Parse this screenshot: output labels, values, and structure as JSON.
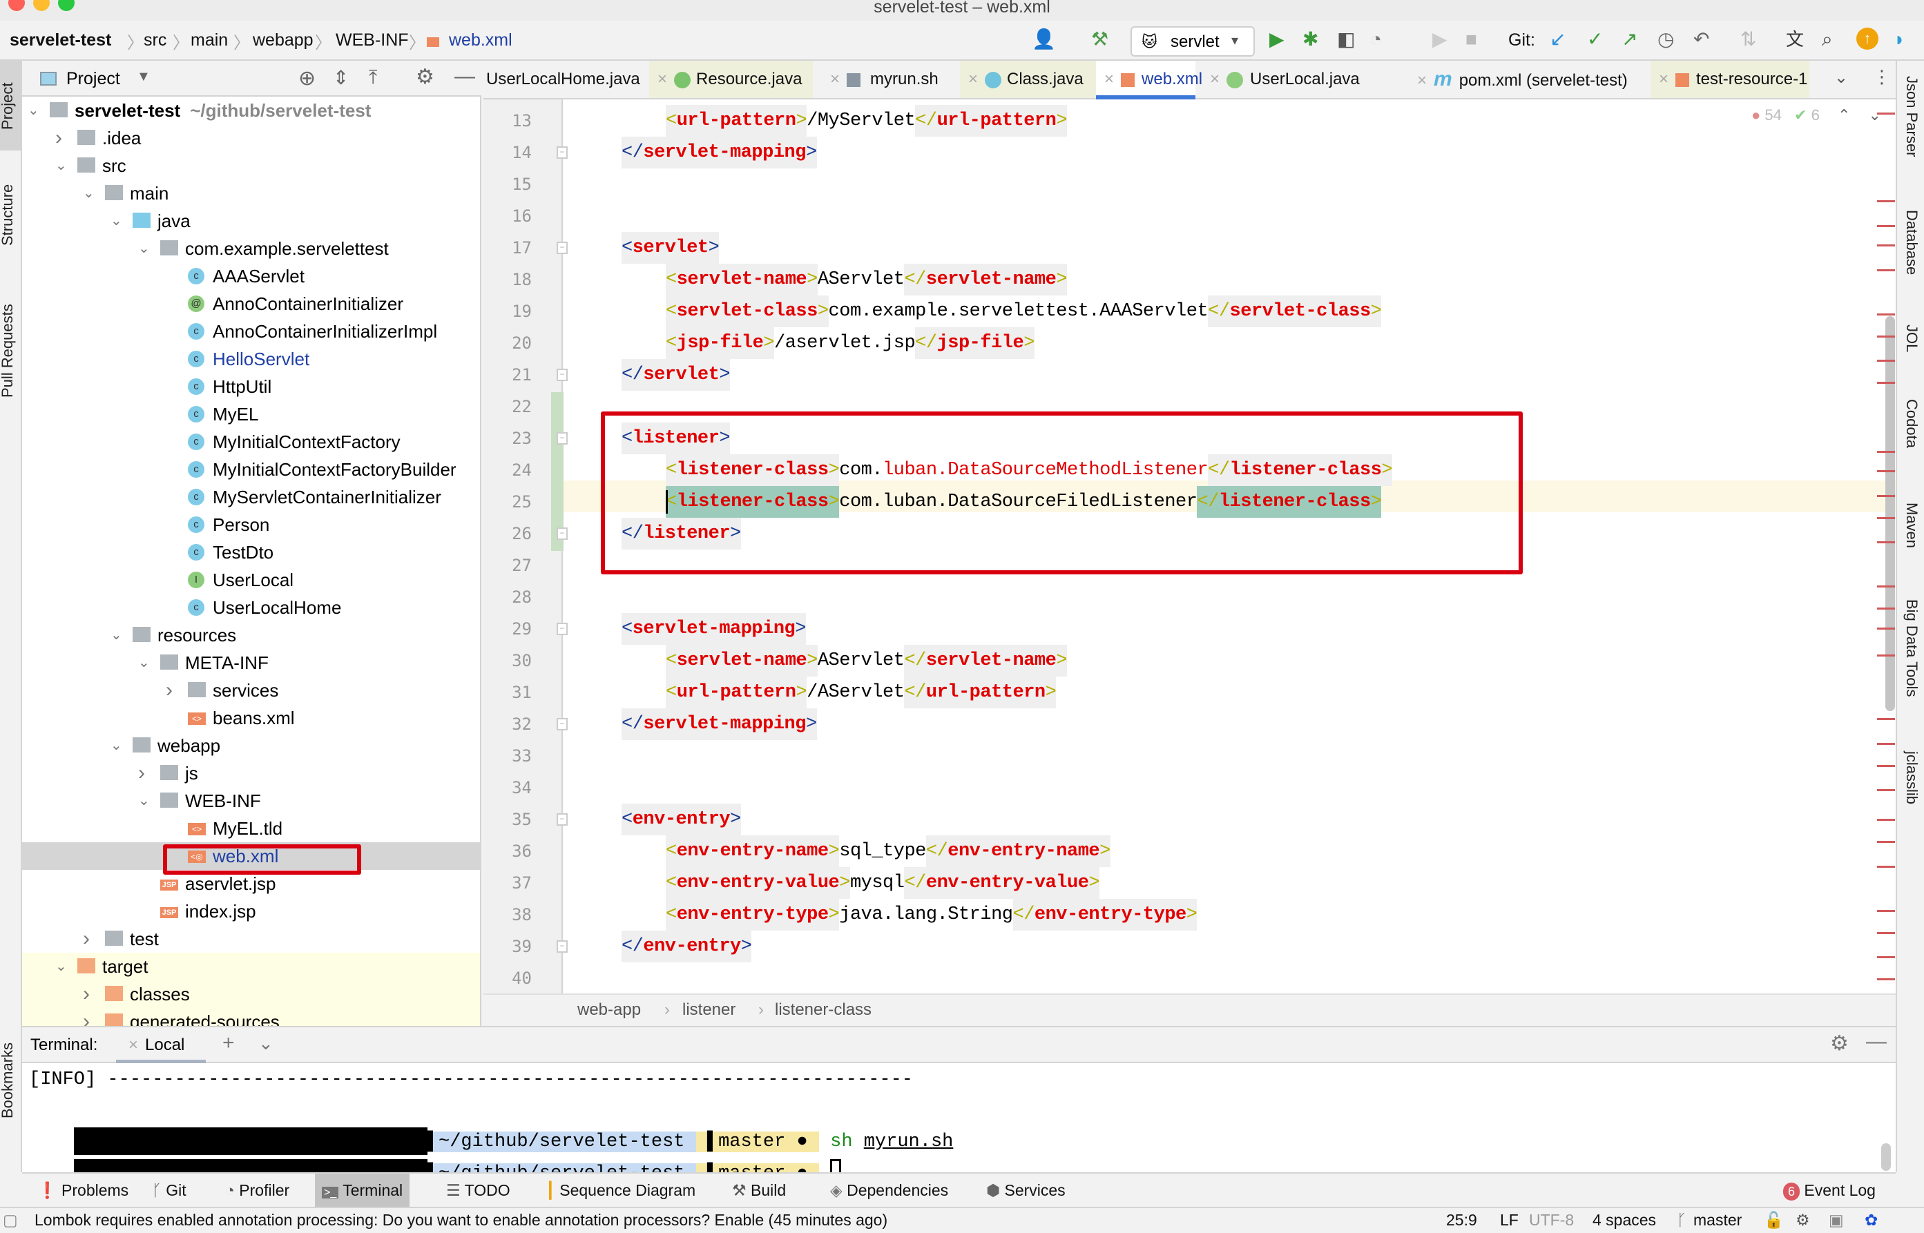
{
  "window": {
    "title": "servelet-test – web.xml"
  },
  "navbar": {
    "breadcrumbs": [
      "servelet-test",
      "src",
      "main",
      "webapp",
      "WEB-INF",
      "web.xml"
    ],
    "run_config": "servlet",
    "git_label": "Git:"
  },
  "left_strip": [
    "Project",
    "Structure",
    "Pull Requests",
    "Bookmarks"
  ],
  "right_strip": [
    "Json Parser",
    "Database",
    "JOL",
    "Codota",
    "Maven",
    "Big Data Tools",
    "jclasslib"
  ],
  "project": {
    "header": "Project",
    "tree": [
      {
        "label": "servelet-test",
        "extra": "~/github/servelet-test",
        "depth": 0,
        "expanded": true,
        "icon": "module",
        "bold": true
      },
      {
        "label": ".idea",
        "depth": 1,
        "expanded": false,
        "icon": "folder"
      },
      {
        "label": "src",
        "depth": 1,
        "expanded": true,
        "icon": "folder"
      },
      {
        "label": "main",
        "depth": 2,
        "expanded": true,
        "icon": "folder"
      },
      {
        "label": "java",
        "depth": 3,
        "expanded": true,
        "icon": "folder-source"
      },
      {
        "label": "com.example.servelettest",
        "depth": 4,
        "expanded": true,
        "icon": "package"
      },
      {
        "label": "AAAServlet",
        "depth": 5,
        "icon": "class"
      },
      {
        "label": "AnnoContainerInitializer",
        "depth": 5,
        "icon": "annotation"
      },
      {
        "label": "AnnoContainerInitializerImpl",
        "depth": 5,
        "icon": "class"
      },
      {
        "label": "HelloServlet",
        "depth": 5,
        "icon": "class",
        "modified": true
      },
      {
        "label": "HttpUtil",
        "depth": 5,
        "icon": "class"
      },
      {
        "label": "MyEL",
        "depth": 5,
        "icon": "class"
      },
      {
        "label": "MyInitialContextFactory",
        "depth": 5,
        "icon": "class"
      },
      {
        "label": "MyInitialContextFactoryBuilder",
        "depth": 5,
        "icon": "class"
      },
      {
        "label": "MyServletContainerInitializer",
        "depth": 5,
        "icon": "class"
      },
      {
        "label": "Person",
        "depth": 5,
        "icon": "class"
      },
      {
        "label": "TestDto",
        "depth": 5,
        "icon": "class"
      },
      {
        "label": "UserLocal",
        "depth": 5,
        "icon": "interface"
      },
      {
        "label": "UserLocalHome",
        "depth": 5,
        "icon": "class"
      },
      {
        "label": "resources",
        "depth": 3,
        "expanded": true,
        "icon": "folder-resources"
      },
      {
        "label": "META-INF",
        "depth": 4,
        "expanded": true,
        "icon": "folder"
      },
      {
        "label": "services",
        "depth": 5,
        "expanded": false,
        "icon": "folder"
      },
      {
        "label": "beans.xml",
        "depth": 5,
        "icon": "xml"
      },
      {
        "label": "webapp",
        "depth": 3,
        "expanded": true,
        "icon": "folder-web"
      },
      {
        "label": "js",
        "depth": 4,
        "expanded": false,
        "icon": "folder"
      },
      {
        "label": "WEB-INF",
        "depth": 4,
        "expanded": true,
        "icon": "folder"
      },
      {
        "label": "MyEL.tld",
        "depth": 5,
        "icon": "xml"
      },
      {
        "label": "web.xml",
        "depth": 5,
        "icon": "webxml",
        "modified": true,
        "selected": true
      },
      {
        "label": "aservlet.jsp",
        "depth": 4,
        "icon": "jsp"
      },
      {
        "label": "index.jsp",
        "depth": 4,
        "icon": "jsp"
      },
      {
        "label": "test",
        "depth": 2,
        "expanded": false,
        "icon": "folder"
      },
      {
        "label": "target",
        "depth": 1,
        "expanded": true,
        "icon": "folder-excluded",
        "excluded": true
      },
      {
        "label": "classes",
        "depth": 2,
        "expanded": false,
        "icon": "folder-excluded",
        "excluded": true
      },
      {
        "label": "generated-sources",
        "depth": 2,
        "expanded": false,
        "icon": "folder-excluded",
        "excluded": true
      }
    ]
  },
  "tabs": [
    {
      "label": "UserLocalHome.java",
      "icon": "class"
    },
    {
      "label": "Resource.java",
      "icon": "annotation"
    },
    {
      "label": "myrun.sh",
      "icon": "shell"
    },
    {
      "label": "Class.java",
      "icon": "class"
    },
    {
      "label": "web.xml",
      "icon": "webxml",
      "active": true,
      "modified": true
    },
    {
      "label": "UserLocal.java",
      "icon": "interface"
    },
    {
      "label": "pom.xml (servelet-test)",
      "icon": "maven"
    },
    {
      "label": "test-resource-1",
      "icon": "xml"
    }
  ],
  "editor": {
    "errors": "54",
    "warnings": "6",
    "cursor_line": 25,
    "lines": [
      {
        "n": "13",
        "indent": 1,
        "parts": [
          [
            "bi",
            "<"
          ],
          [
            "tn",
            "url-pattern"
          ],
          [
            "bi",
            ">"
          ],
          [
            "t",
            "/MyServlet"
          ],
          [
            "bi",
            "</"
          ],
          [
            "tn",
            "url-pattern"
          ],
          [
            "bi",
            ">"
          ]
        ]
      },
      {
        "n": "14",
        "indent": 0,
        "parts": [
          [
            "bo",
            "</"
          ],
          [
            "tn",
            "servlet-mapping"
          ],
          [
            "bo",
            ">"
          ]
        ]
      },
      {
        "n": "15",
        "indent": 0,
        "parts": []
      },
      {
        "n": "16",
        "indent": 0,
        "parts": []
      },
      {
        "n": "17",
        "indent": 0,
        "parts": [
          [
            "bo",
            "<"
          ],
          [
            "tn",
            "servlet"
          ],
          [
            "bo",
            ">"
          ]
        ]
      },
      {
        "n": "18",
        "indent": 1,
        "parts": [
          [
            "bi",
            "<"
          ],
          [
            "tn",
            "servlet-name"
          ],
          [
            "bi",
            ">"
          ],
          [
            "t",
            "AServlet"
          ],
          [
            "bi",
            "</"
          ],
          [
            "tn",
            "servlet-name"
          ],
          [
            "bi",
            ">"
          ]
        ]
      },
      {
        "n": "19",
        "indent": 1,
        "parts": [
          [
            "bi",
            "<"
          ],
          [
            "tn",
            "servlet-class"
          ],
          [
            "bi",
            ">"
          ],
          [
            "t",
            "com.example.servelettest.AAAServlet"
          ],
          [
            "bi",
            "</"
          ],
          [
            "tn",
            "servlet-class"
          ],
          [
            "bi",
            ">"
          ]
        ]
      },
      {
        "n": "20",
        "indent": 1,
        "parts": [
          [
            "bi",
            "<"
          ],
          [
            "tn",
            "jsp-file"
          ],
          [
            "bi",
            ">"
          ],
          [
            "t",
            "/aservlet.jsp"
          ],
          [
            "bi",
            "</"
          ],
          [
            "tn",
            "jsp-file"
          ],
          [
            "bi",
            ">"
          ]
        ]
      },
      {
        "n": "21",
        "indent": 0,
        "parts": [
          [
            "bo",
            "</"
          ],
          [
            "tn",
            "servlet"
          ],
          [
            "bo",
            ">"
          ]
        ]
      },
      {
        "n": "22",
        "indent": 0,
        "parts": []
      },
      {
        "n": "23",
        "indent": 0,
        "parts": [
          [
            "bo",
            "<"
          ],
          [
            "tn",
            "listener"
          ],
          [
            "bo",
            ">"
          ]
        ]
      },
      {
        "n": "24",
        "indent": 1,
        "parts": [
          [
            "bi",
            "<"
          ],
          [
            "tn",
            "listener-class"
          ],
          [
            "bi",
            ">"
          ],
          [
            "t",
            "com."
          ],
          [
            "u",
            "luban.DataSourceMethodListener"
          ],
          [
            "bi",
            "</"
          ],
          [
            "tn",
            "listener-class"
          ],
          [
            "bi",
            ">"
          ]
        ]
      },
      {
        "n": "25",
        "indent": 1,
        "hl": true,
        "parts": [
          [
            "bi",
            "<"
          ],
          [
            "tn",
            "listener-class"
          ],
          [
            "bi",
            ">"
          ],
          [
            "t",
            "com.luban.DataSourceFiledListener"
          ],
          [
            "bi",
            "</"
          ],
          [
            "tn",
            "listener-class"
          ],
          [
            "bi",
            ">"
          ]
        ]
      },
      {
        "n": "26",
        "indent": 0,
        "parts": [
          [
            "bo",
            "</"
          ],
          [
            "tn",
            "listener"
          ],
          [
            "bo",
            ">"
          ]
        ]
      },
      {
        "n": "27",
        "indent": 0,
        "parts": []
      },
      {
        "n": "28",
        "indent": 0,
        "parts": []
      },
      {
        "n": "29",
        "indent": 0,
        "parts": [
          [
            "bo",
            "<"
          ],
          [
            "tn",
            "servlet-mapping"
          ],
          [
            "bo",
            ">"
          ]
        ]
      },
      {
        "n": "30",
        "indent": 1,
        "parts": [
          [
            "bi",
            "<"
          ],
          [
            "tn",
            "servlet-name"
          ],
          [
            "bi",
            ">"
          ],
          [
            "t",
            "AServlet"
          ],
          [
            "bi",
            "</"
          ],
          [
            "tn",
            "servlet-name"
          ],
          [
            "bi",
            ">"
          ]
        ]
      },
      {
        "n": "31",
        "indent": 1,
        "parts": [
          [
            "bi",
            "<"
          ],
          [
            "tn",
            "url-pattern"
          ],
          [
            "bi",
            ">"
          ],
          [
            "t",
            "/AServlet"
          ],
          [
            "bi",
            "</"
          ],
          [
            "tn",
            "url-pattern"
          ],
          [
            "bi",
            ">"
          ]
        ]
      },
      {
        "n": "32",
        "indent": 0,
        "parts": [
          [
            "bo",
            "</"
          ],
          [
            "tn",
            "servlet-mapping"
          ],
          [
            "bo",
            ">"
          ]
        ]
      },
      {
        "n": "33",
        "indent": 0,
        "parts": []
      },
      {
        "n": "34",
        "indent": 0,
        "parts": []
      },
      {
        "n": "35",
        "indent": 0,
        "parts": [
          [
            "bo",
            "<"
          ],
          [
            "tn",
            "env-entry"
          ],
          [
            "bo",
            ">"
          ]
        ]
      },
      {
        "n": "36",
        "indent": 1,
        "parts": [
          [
            "bi",
            "<"
          ],
          [
            "tn",
            "env-entry-name"
          ],
          [
            "bi",
            ">"
          ],
          [
            "t",
            "sql_type"
          ],
          [
            "bi",
            "</"
          ],
          [
            "tn",
            "env-entry-name"
          ],
          [
            "bi",
            ">"
          ]
        ]
      },
      {
        "n": "37",
        "indent": 1,
        "parts": [
          [
            "bi",
            "<"
          ],
          [
            "tn",
            "env-entry-value"
          ],
          [
            "bi",
            ">"
          ],
          [
            "t",
            "mysql"
          ],
          [
            "bi",
            "</"
          ],
          [
            "tn",
            "env-entry-value"
          ],
          [
            "bi",
            ">"
          ]
        ]
      },
      {
        "n": "38",
        "indent": 1,
        "parts": [
          [
            "bi",
            "<"
          ],
          [
            "tn",
            "env-entry-type"
          ],
          [
            "bi",
            ">"
          ],
          [
            "t",
            "java.lang.String"
          ],
          [
            "bi",
            "</"
          ],
          [
            "tn",
            "env-entry-type"
          ],
          [
            "bi",
            ">"
          ]
        ]
      },
      {
        "n": "39",
        "indent": 0,
        "parts": [
          [
            "bo",
            "</"
          ],
          [
            "tn",
            "env-entry"
          ],
          [
            "bo",
            ">"
          ]
        ]
      },
      {
        "n": "40",
        "indent": 0,
        "parts": []
      }
    ],
    "breadcrumb": [
      "web-app",
      "listener",
      "listener-class"
    ]
  },
  "terminal": {
    "label": "Terminal:",
    "tab": "Local",
    "info_line": "[INFO] ------------------------------------------------------------------------",
    "prompt_path": "~/github/servelet-test",
    "prompt_branch": "master",
    "prompt_dot": "●",
    "command_name": "sh",
    "command_arg": "myrun.sh"
  },
  "toolwindows": [
    "Problems",
    "Git",
    "Profiler",
    "Terminal",
    "TODO",
    "Sequence Diagram",
    "Build",
    "Dependencies",
    "Services"
  ],
  "active_toolwindow": "Terminal",
  "event_log": {
    "label": "Event Log",
    "count": "6"
  },
  "status": {
    "message": "Lombok requires enabled annotation processing: Do you want to enable annotation processors? Enable (45 minutes ago)",
    "position": "25:9",
    "line_sep": "LF",
    "encoding": "UTF-8",
    "indent": "4 spaces",
    "branch": "master"
  },
  "colors": {
    "accent": "#3b78d8",
    "error": "#d8000f",
    "tag": "#e00000",
    "bracket_outer": "#1a3c94",
    "bracket_inner": "#b4b000"
  }
}
